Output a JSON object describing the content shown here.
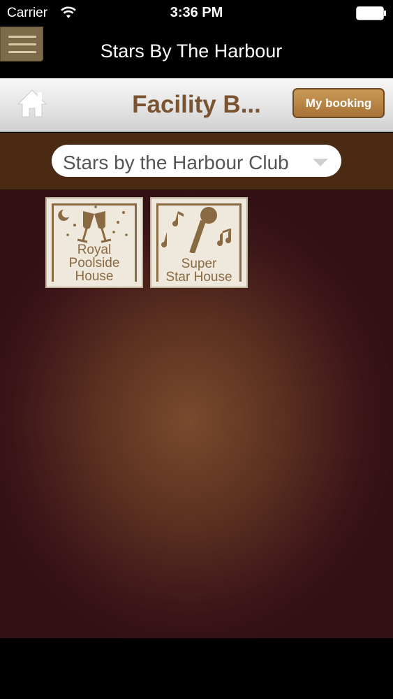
{
  "status_bar": {
    "carrier": "Carrier",
    "time": "3:36 PM",
    "icons": [
      "wifi-icon",
      "battery-icon"
    ]
  },
  "app_bar": {
    "title": "Stars By The Harbour",
    "menu_icon": "hamburger-menu-icon"
  },
  "header": {
    "home_icon": "home-icon",
    "title": "Facility B...",
    "my_booking_label": "My booking"
  },
  "club_selector": {
    "selected": "Stars by the Harbour Club",
    "icon": "chevron-down-icon"
  },
  "facilities": [
    {
      "line1": "Royal",
      "line2": "Poolside",
      "line3": "House",
      "icon": "champagne-glasses-icon"
    },
    {
      "line1": "Super",
      "line2": "Star House",
      "icon": "microphone-music-icon"
    }
  ],
  "colors": {
    "accent_brown": "#7a5430",
    "button_gold": "#b5823f",
    "band_brown": "#4a2a12",
    "background_dark": "#3a1418"
  }
}
